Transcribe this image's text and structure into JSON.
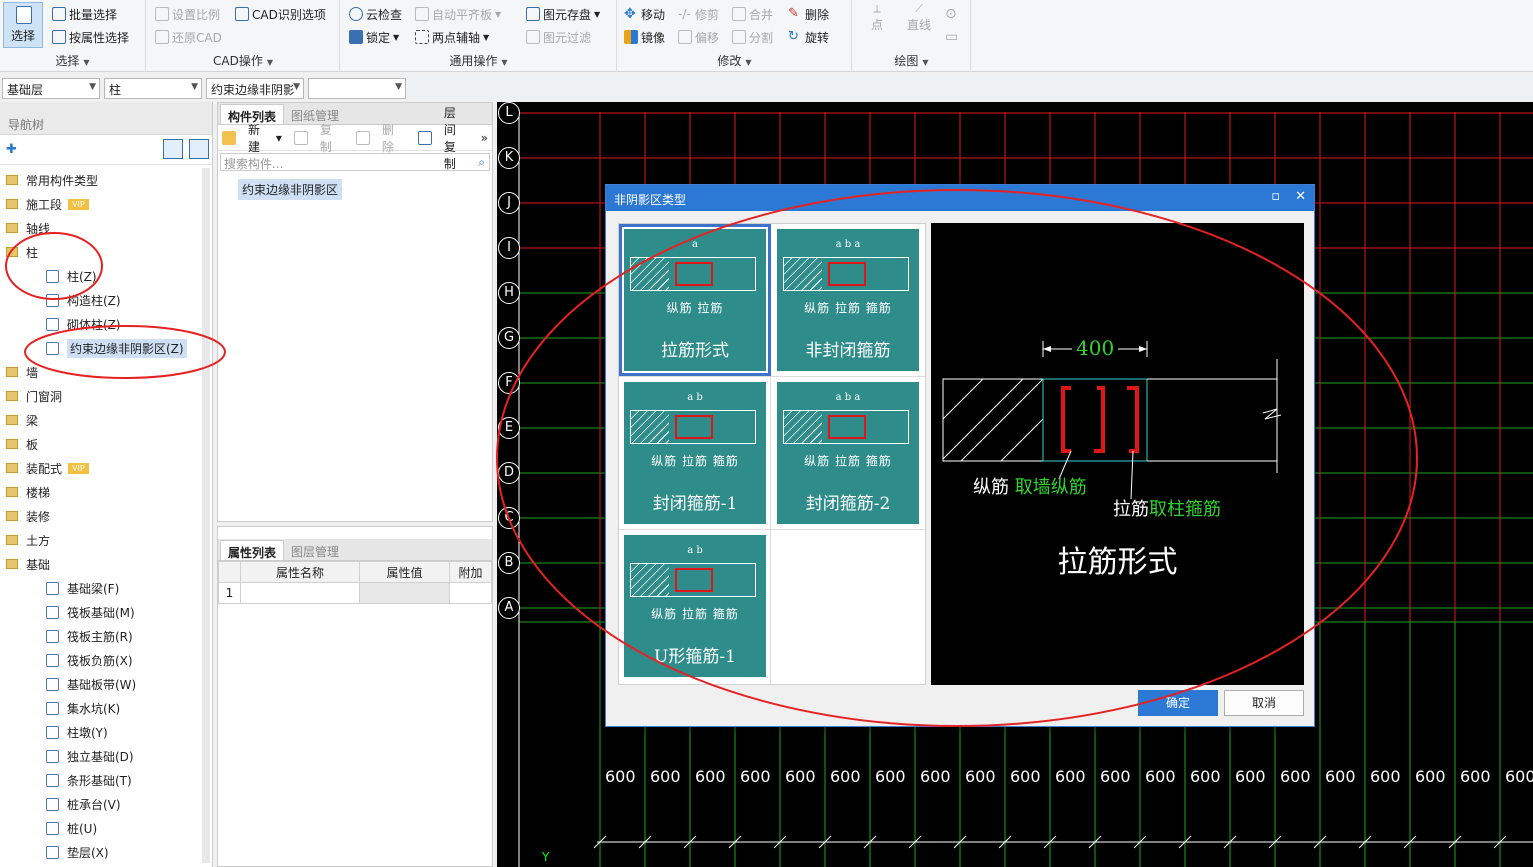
{
  "ribbon": {
    "select_group": {
      "label": "选择",
      "big_button": "选择",
      "batch_select": "批量选择",
      "select_by_attr": "按属性选择"
    },
    "cad_group": {
      "label": "CAD操作",
      "set_scale": "设置比例",
      "restore_cad": "还原CAD",
      "cad_options": "CAD识别选项"
    },
    "general_group": {
      "label": "通用操作",
      "cloud_check": "云检查",
      "lock": "锁定",
      "auto_align": "自动平齐板",
      "two_point_axis": "两点辅轴",
      "save_element": "图元存盘",
      "element_filter": "图元过滤"
    },
    "modify_group": {
      "label": "修改",
      "move": "移动",
      "trim": "修剪",
      "merge": "合并",
      "delete": "删除",
      "mirror": "镜像",
      "offset": "偏移",
      "split": "分割",
      "rotate": "旋转"
    },
    "draw_group": {
      "label": "绘图",
      "point": "点",
      "line": "直线"
    }
  },
  "combos": {
    "floor": "基础层",
    "category": "柱",
    "component": "约束边缘非阴影",
    "blank": ""
  },
  "nav": {
    "title": "导航树",
    "items": [
      {
        "label": "常用构件类型",
        "type": "folder"
      },
      {
        "label": "施工段",
        "type": "folder",
        "vip": "VIP"
      },
      {
        "label": "轴线",
        "type": "folder"
      },
      {
        "label": "柱",
        "type": "folder"
      },
      {
        "label": "柱(Z)",
        "type": "leaf"
      },
      {
        "label": "构造柱(Z)",
        "type": "leaf"
      },
      {
        "label": "砌体柱(Z)",
        "type": "leaf"
      },
      {
        "label": "约束边缘非阴影区(Z)",
        "type": "leaf",
        "selected": true
      },
      {
        "label": "墙",
        "type": "folder"
      },
      {
        "label": "门窗洞",
        "type": "folder"
      },
      {
        "label": "梁",
        "type": "folder"
      },
      {
        "label": "板",
        "type": "folder"
      },
      {
        "label": "装配式",
        "type": "folder",
        "vip": "VIP"
      },
      {
        "label": "楼梯",
        "type": "folder"
      },
      {
        "label": "装修",
        "type": "folder"
      },
      {
        "label": "土方",
        "type": "folder"
      },
      {
        "label": "基础",
        "type": "folder"
      },
      {
        "label": "基础梁(F)",
        "type": "leaf"
      },
      {
        "label": "筏板基础(M)",
        "type": "leaf"
      },
      {
        "label": "筏板主筋(R)",
        "type": "leaf"
      },
      {
        "label": "筏板负筋(X)",
        "type": "leaf"
      },
      {
        "label": "基础板带(W)",
        "type": "leaf"
      },
      {
        "label": "集水坑(K)",
        "type": "leaf"
      },
      {
        "label": "柱墩(Y)",
        "type": "leaf"
      },
      {
        "label": "独立基础(D)",
        "type": "leaf"
      },
      {
        "label": "条形基础(T)",
        "type": "leaf"
      },
      {
        "label": "桩承台(V)",
        "type": "leaf"
      },
      {
        "label": "桩(U)",
        "type": "leaf"
      },
      {
        "label": "垫层(X)",
        "type": "leaf"
      }
    ]
  },
  "component_panel": {
    "tabs": [
      "构件列表",
      "图纸管理"
    ],
    "toolbar": {
      "new": "新建",
      "copy": "复制",
      "delete": "删除",
      "floor_copy": "层间复制"
    },
    "search_placeholder": "搜索构件...",
    "items": [
      "约束边缘非阴影区"
    ]
  },
  "property_panel": {
    "tabs": [
      "属性列表",
      "图层管理"
    ],
    "columns": [
      "属性名称",
      "属性值",
      "附加"
    ],
    "rows": [
      {
        "index": "1",
        "name": "",
        "value": "",
        "extra": ""
      }
    ]
  },
  "cad": {
    "axis_labels": [
      "L",
      "K",
      "J",
      "I",
      "H",
      "G",
      "F",
      "E",
      "D",
      "C",
      "B",
      "A"
    ],
    "dimension_value": "600",
    "dimension_count": 21,
    "y_label": "Y"
  },
  "dialog": {
    "title": "非阴影区类型",
    "options": [
      {
        "name": "拉筋形式",
        "sub": "纵筋   拉筋",
        "top_dim": "a",
        "selected": true
      },
      {
        "name": "非封闭箍筋",
        "sub": "纵筋 拉筋 箍筋",
        "top_dim": "a  b  a"
      },
      {
        "name": "封闭箍筋-1",
        "sub": "纵筋 拉筋 箍筋",
        "top_dim": "a  b"
      },
      {
        "name": "封闭箍筋-2",
        "sub": "纵筋 拉筋 箍筋",
        "top_dim": "a  b  a"
      },
      {
        "name": "U形箍筋-1",
        "sub": "纵筋 拉筋 箍筋",
        "top_dim": "a  b"
      }
    ],
    "preview": {
      "dimension": "400",
      "label1_white": "纵筋",
      "label1_green": "取墙纵筋",
      "label2_white": "拉筋",
      "label2_green": "取柱箍筋",
      "title": "拉筋形式"
    },
    "ok": "确定",
    "cancel": "取消"
  },
  "colors": {
    "accent": "#2b79d5",
    "option_bg": "#2e8c8a",
    "grid_red": "#e0191b",
    "grid_green": "#1fa21f",
    "annotation": "#e52222"
  }
}
